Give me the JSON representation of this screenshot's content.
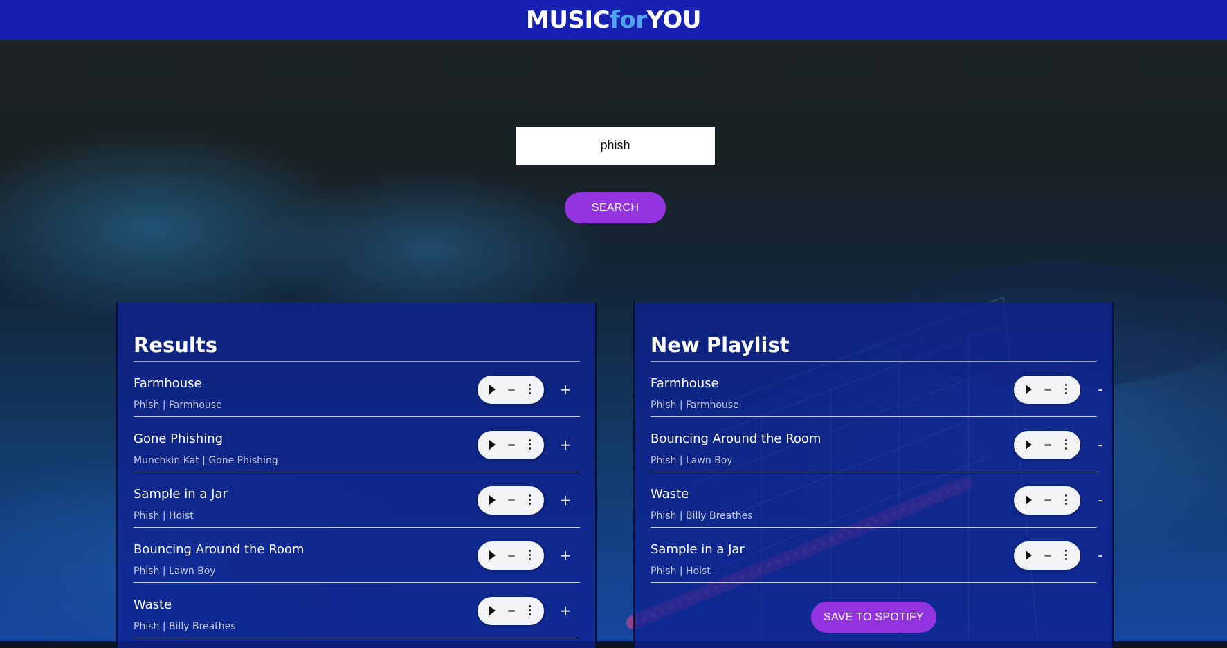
{
  "header": {
    "logo_part1": "MUSIC",
    "logo_part2": "for",
    "logo_part3": "YOU",
    "bg_color": "#1720b1",
    "accent_color": "#4fa6ee"
  },
  "search": {
    "value": "phish",
    "button_label": "SEARCH"
  },
  "results": {
    "title": "Results",
    "add_label": "+",
    "tracks": [
      {
        "name": "Farmhouse",
        "meta": "Phish | Farmhouse"
      },
      {
        "name": "Gone Phishing",
        "meta": "Munchkin Kat | Gone Phishing"
      },
      {
        "name": "Sample in a Jar",
        "meta": "Phish | Hoist"
      },
      {
        "name": "Bouncing Around the Room",
        "meta": "Phish | Lawn Boy"
      },
      {
        "name": "Waste",
        "meta": "Phish | Billy Breathes"
      }
    ]
  },
  "playlist": {
    "title": "New Playlist",
    "remove_label": "-",
    "save_label": "SAVE TO SPOTIFY",
    "tracks": [
      {
        "name": "Farmhouse",
        "meta": "Phish | Farmhouse"
      },
      {
        "name": "Bouncing Around the Room",
        "meta": "Phish | Lawn Boy"
      },
      {
        "name": "Waste",
        "meta": "Phish | Billy Breathes"
      },
      {
        "name": "Sample in a Jar",
        "meta": "Phish | Hoist"
      }
    ]
  },
  "colors": {
    "button": "#9433e0",
    "panel": "#0e2191"
  }
}
